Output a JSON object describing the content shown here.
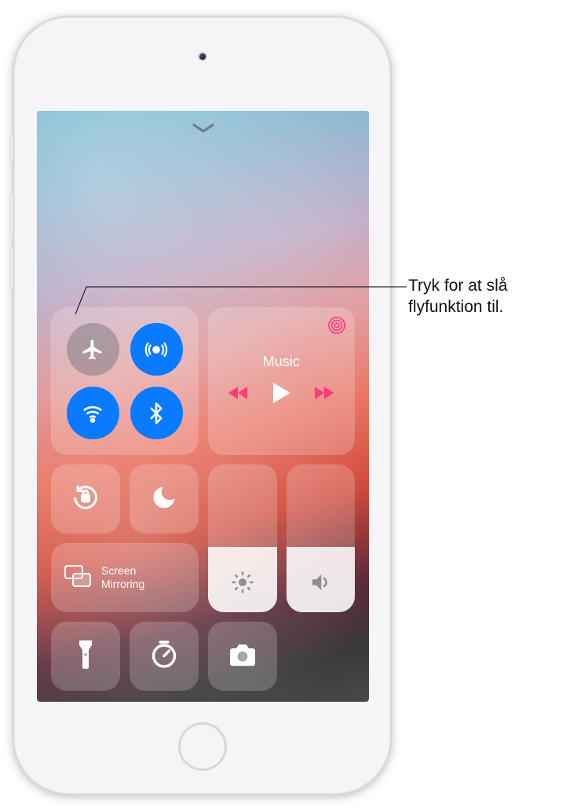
{
  "callout": {
    "text": "Tryk for at slå flyfunktion til."
  },
  "control_center": {
    "connectivity": {
      "airplane": {
        "on": false,
        "name": "airplane-mode"
      },
      "airdrop": {
        "on": true,
        "name": "airdrop"
      },
      "wifi": {
        "on": true,
        "name": "wifi"
      },
      "bluetooth": {
        "on": true,
        "name": "bluetooth"
      }
    },
    "media": {
      "title": "Music",
      "playing": false
    },
    "orientation_lock": {
      "on": false
    },
    "do_not_disturb": {
      "on": false
    },
    "screen_mirroring": {
      "label": "Screen\nMirroring"
    },
    "brightness": {
      "level_percent": 44
    },
    "volume": {
      "level_percent": 44
    },
    "shortcuts": {
      "flashlight": true,
      "timer": true,
      "camera": true
    }
  }
}
